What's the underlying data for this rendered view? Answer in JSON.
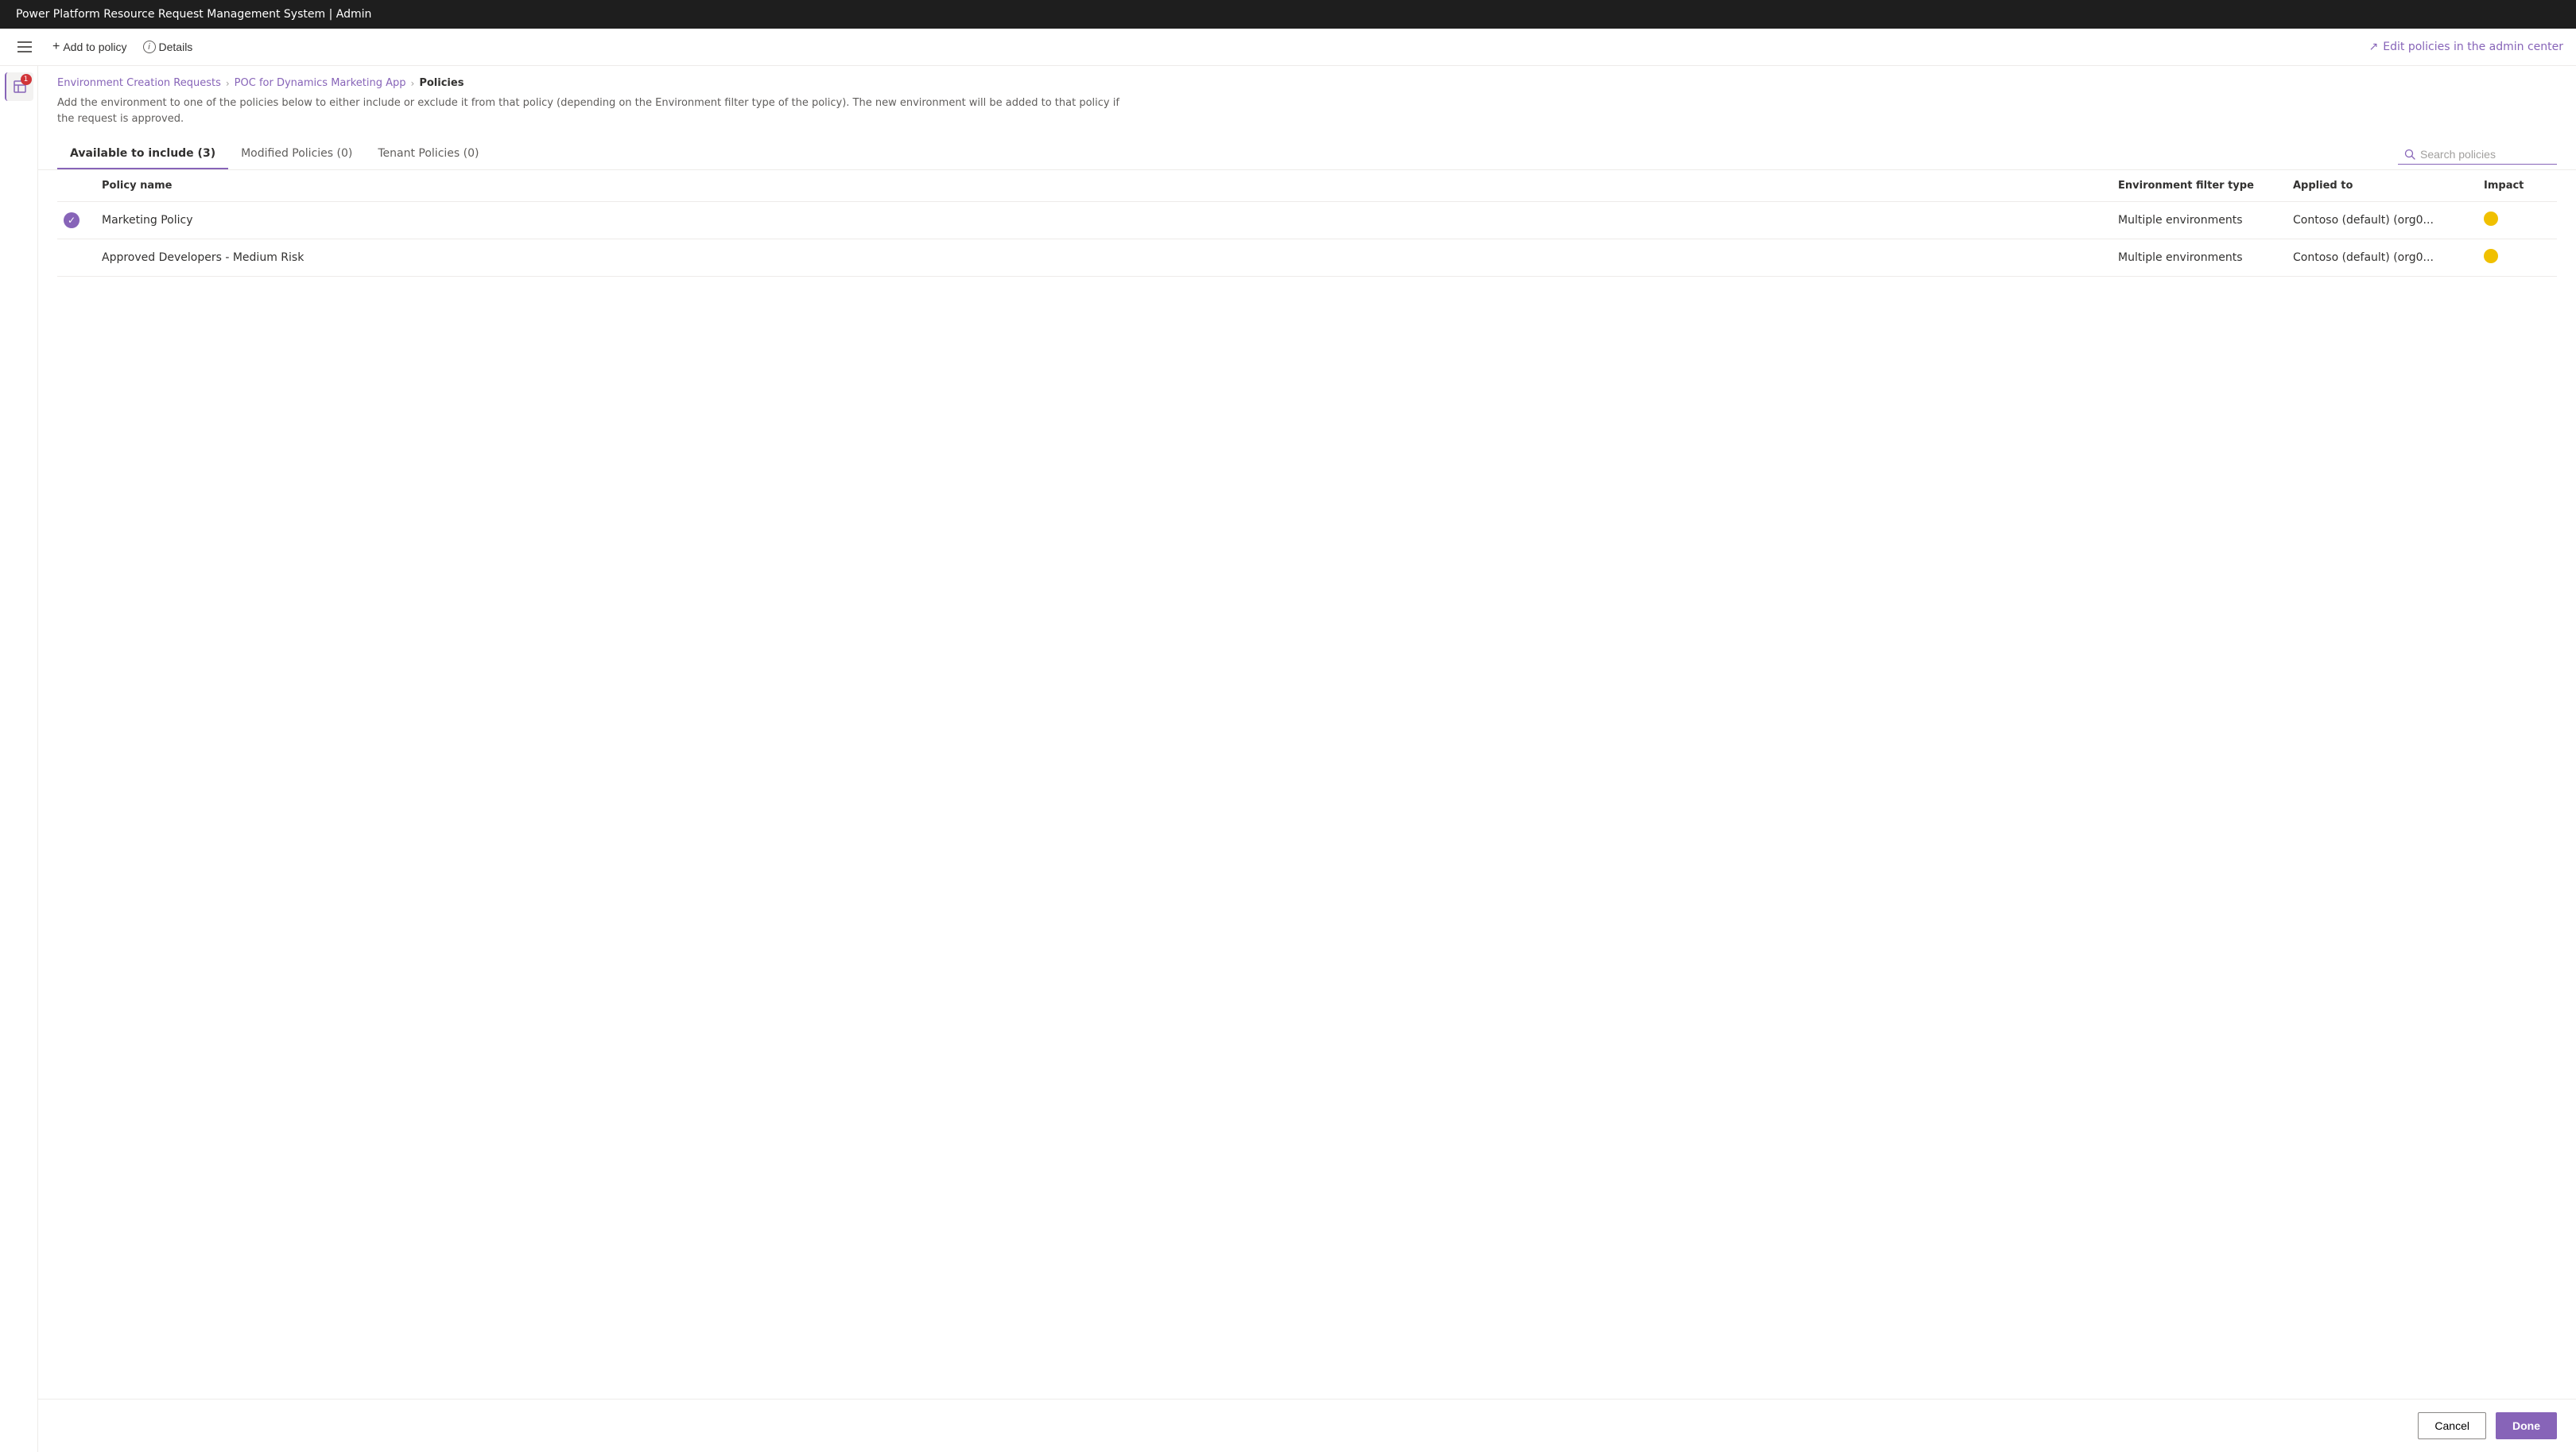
{
  "titleBar": {
    "text": "Power Platform Resource Request Management System | Admin"
  },
  "toolbar": {
    "addToPolicyLabel": "Add to policy",
    "detailsLabel": "Details",
    "editPoliciesLabel": "Edit policies in the admin center"
  },
  "breadcrumb": {
    "step1": "Environment Creation Requests",
    "step2": "POC for Dynamics Marketing App",
    "step3": "Policies"
  },
  "description": "Add the environment to one of the policies below to either include or exclude it from that policy (depending on the Environment filter type of the policy). The new environment will be added to that policy if the request is approved.",
  "tabs": [
    {
      "label": "Available to include (3)",
      "active": true
    },
    {
      "label": "Modified Policies (0)",
      "active": false
    },
    {
      "label": "Tenant Policies (0)",
      "active": false
    }
  ],
  "search": {
    "placeholder": "Search policies"
  },
  "table": {
    "columns": [
      {
        "key": "check",
        "label": ""
      },
      {
        "key": "policyName",
        "label": "Policy name"
      },
      {
        "key": "envFilterType",
        "label": "Environment filter type"
      },
      {
        "key": "appliedTo",
        "label": "Applied to"
      },
      {
        "key": "impact",
        "label": "Impact"
      }
    ],
    "rows": [
      {
        "checked": true,
        "policyName": "Marketing Policy",
        "envFilterType": "Multiple environments",
        "appliedTo": "Contoso (default) (org0...",
        "impactColor": "#f0c000"
      },
      {
        "checked": false,
        "policyName": "Approved Developers - Medium Risk",
        "envFilterType": "Multiple environments",
        "appliedTo": "Contoso (default) (org0...",
        "impactColor": "#f0c000"
      }
    ]
  },
  "footer": {
    "cancelLabel": "Cancel",
    "doneLabel": "Done"
  }
}
